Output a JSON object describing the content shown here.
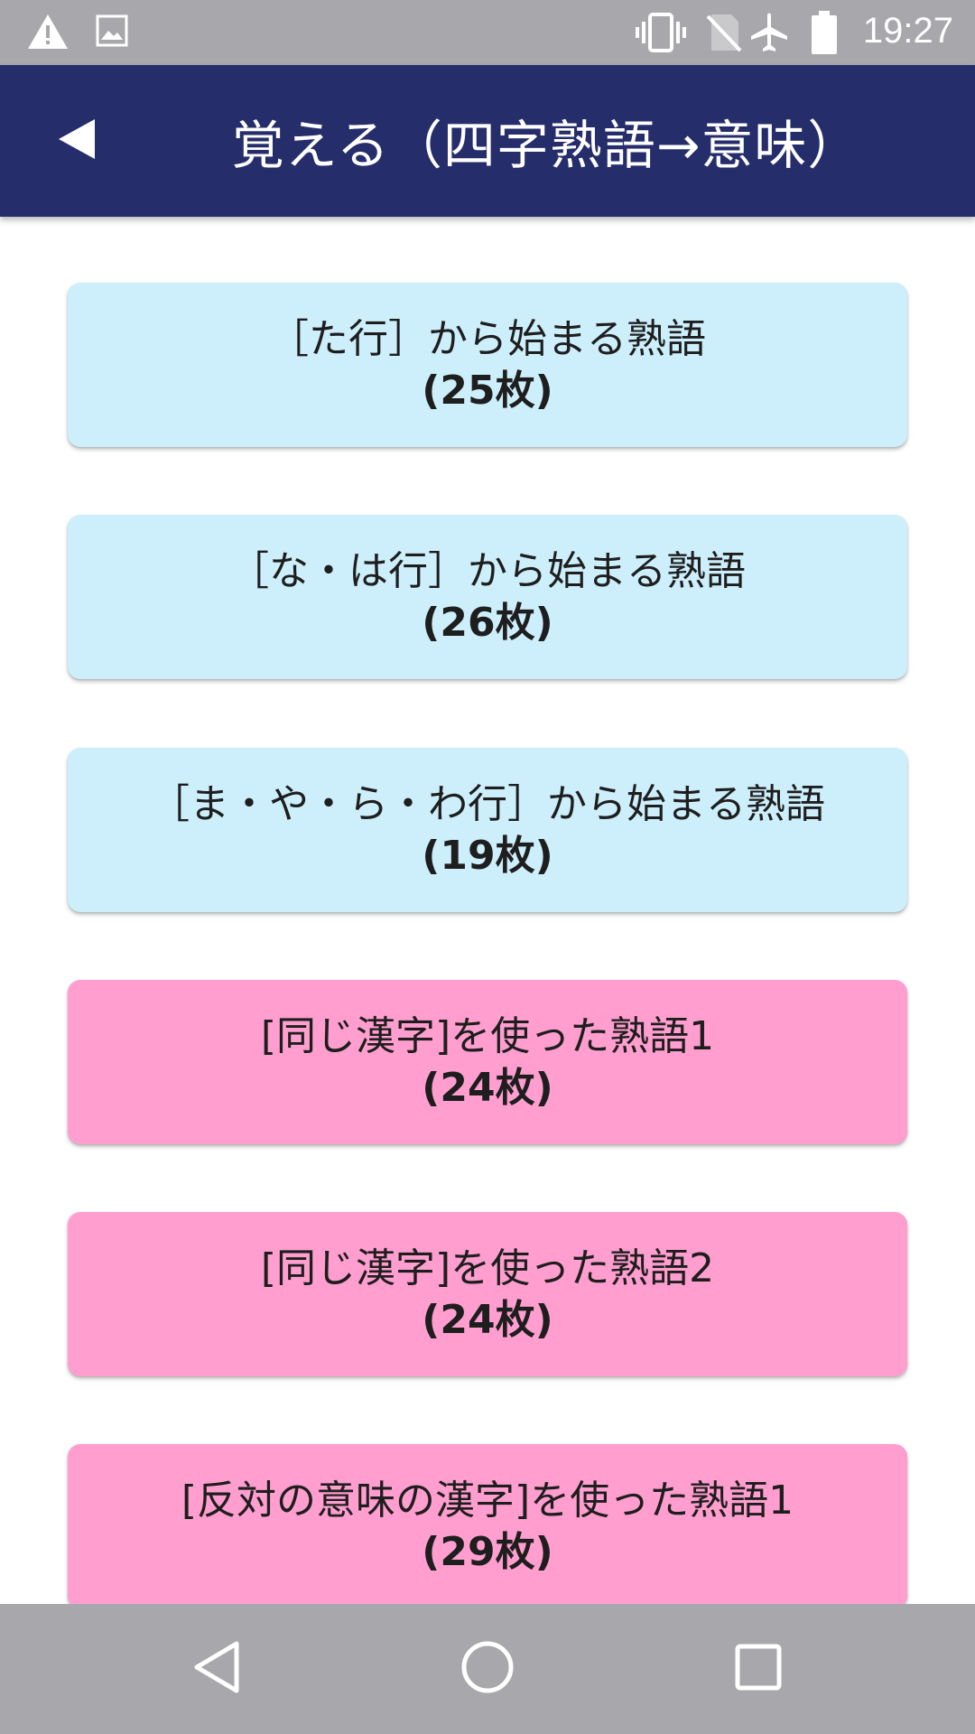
{
  "status_bar": {
    "time": "19:27",
    "icons": [
      "warning-icon",
      "image-icon",
      "vibrate-icon",
      "no-sim-icon",
      "airplane-icon",
      "battery-icon"
    ]
  },
  "app_bar": {
    "title": "覚える（四字熟語→意味）",
    "back_icon": "back-arrow-icon",
    "background": "#262d6b"
  },
  "cards": [
    {
      "title": "［た行］から始まる熟語",
      "count": "(25枚)",
      "color": "#cdeffb"
    },
    {
      "title": "［な・は行］から始まる熟語",
      "count": "(26枚)",
      "color": "#cdeffb"
    },
    {
      "title": "［ま・や・ら・わ行］から始まる熟語",
      "count": "(19枚)",
      "color": "#cdeffb"
    },
    {
      "title": "[同じ漢字]を使った熟語1",
      "count": "(24枚)",
      "color": "#ff9ecf"
    },
    {
      "title": "[同じ漢字]を使った熟語2",
      "count": "(24枚)",
      "color": "#ff9ecf"
    },
    {
      "title": "[反対の意味の漢字]を使った熟語1",
      "count": "(29枚)",
      "color": "#ff9ecf"
    }
  ],
  "nav_bar": {
    "icons": [
      "nav-back-icon",
      "nav-home-icon",
      "nav-recents-icon"
    ]
  }
}
